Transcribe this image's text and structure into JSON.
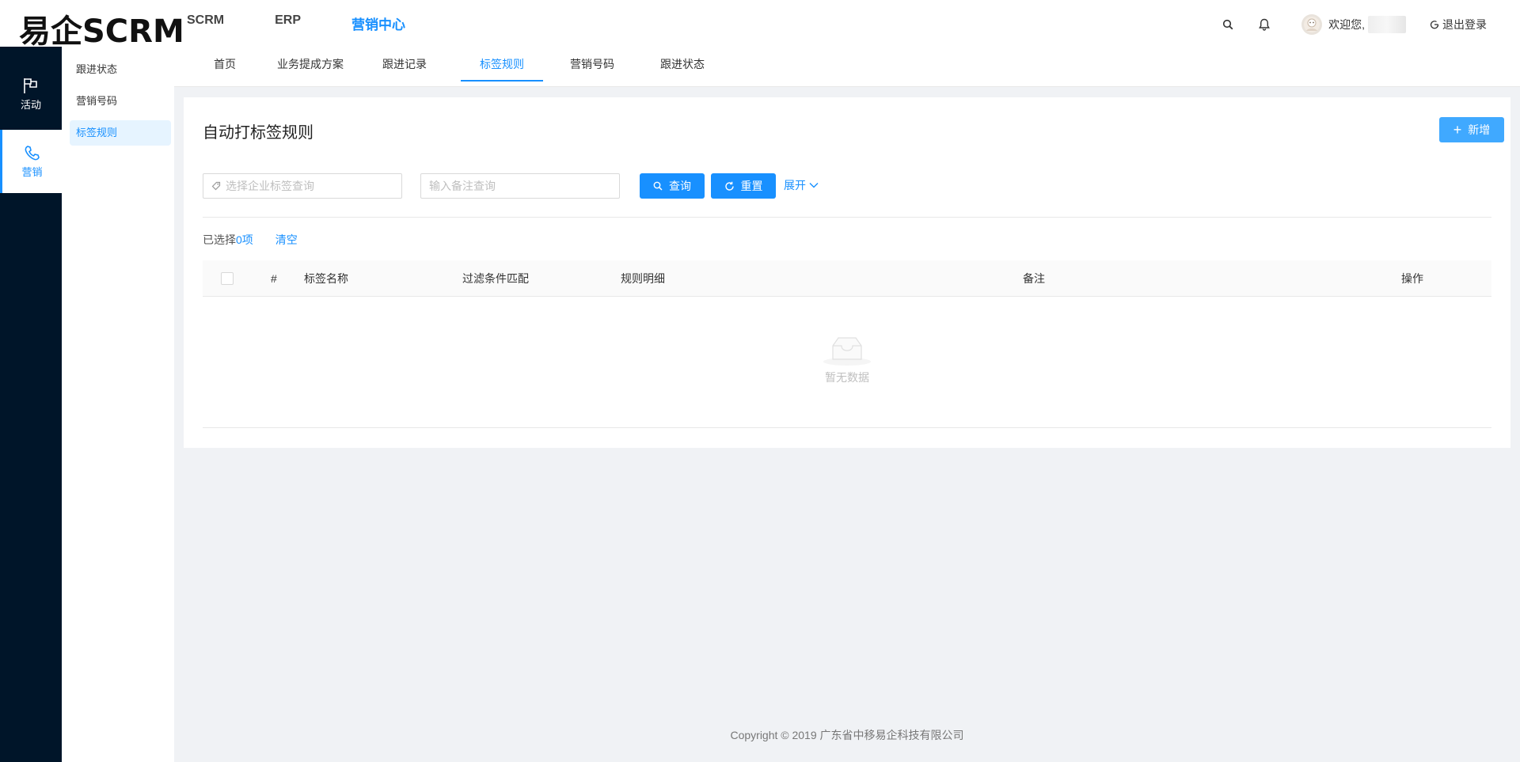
{
  "app": {
    "logo": "易企SCRM"
  },
  "topnav": [
    {
      "label": "SCRM",
      "active": false
    },
    {
      "label": "ERP",
      "active": false
    },
    {
      "label": "营销中心",
      "active": true
    }
  ],
  "header": {
    "welcome": "欢迎您,",
    "logout": "退出登录"
  },
  "darkbar": {
    "activity": "活动",
    "marketing": "营销"
  },
  "subnav": [
    {
      "label": "跟进状态",
      "active": false
    },
    {
      "label": "营销号码",
      "active": false
    },
    {
      "label": "标签规则",
      "active": true
    }
  ],
  "tabs": [
    {
      "label": "首页",
      "active": false
    },
    {
      "label": "业务提成方案",
      "active": false
    },
    {
      "label": "跟进记录",
      "active": false
    },
    {
      "label": "标签规则",
      "active": true
    },
    {
      "label": "营销号码",
      "active": false
    },
    {
      "label": "跟进状态",
      "active": false
    }
  ],
  "main": {
    "title": "自动打标签规则",
    "new_button": "新增",
    "tag_placeholder": "选择企业标签查询",
    "note_placeholder": "输入备注查询",
    "query_button": "查询",
    "reset_button": "重置",
    "expand": "展开",
    "selected_prefix": "已选择",
    "selected_count": "0项",
    "clear": "清空"
  },
  "table": {
    "columns": [
      "#",
      "标签名称",
      "过滤条件匹配",
      "规则明细",
      "备注",
      "操作"
    ],
    "empty_text": "暂无数据"
  },
  "footer": {
    "copyright": "Copyright © 2019 广东省中移易企科技有限公司"
  },
  "colors": {
    "primary": "#1890ff",
    "sidebar_dark": "#001529",
    "background": "#f0f2f5"
  }
}
